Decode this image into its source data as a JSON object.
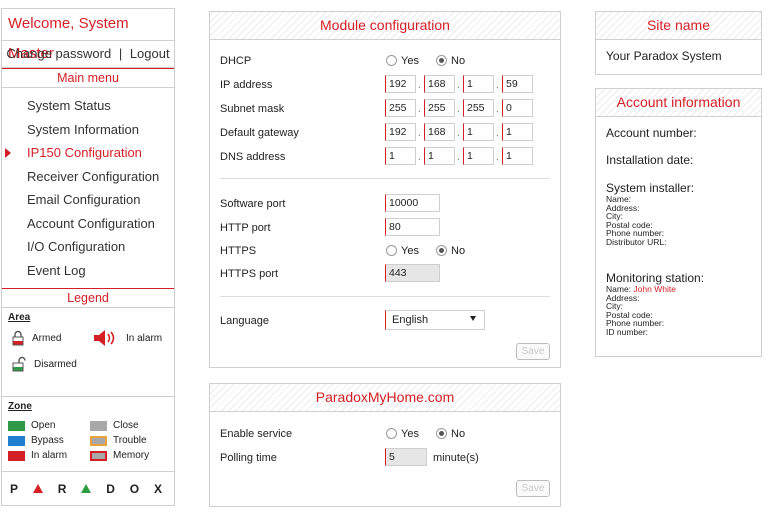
{
  "sidebar": {
    "welcome": "Welcome, System Master",
    "change_password": "Change password",
    "separator": "|",
    "logout": "Logout",
    "main_menu_title": "Main menu",
    "menu_items": [
      {
        "label": "System Status"
      },
      {
        "label": "System Information"
      },
      {
        "label": "IP150 Configuration"
      },
      {
        "label": "Receiver Configuration"
      },
      {
        "label": "Email Configuration"
      },
      {
        "label": "Account Configuration"
      },
      {
        "label": "I/O Configuration"
      },
      {
        "label": "Event Log"
      }
    ],
    "active_item": "IP150 Configuration",
    "legend_title": "Legend",
    "legend": {
      "area_title": "Area",
      "armed": "Armed",
      "in_alarm": "In alarm",
      "disarmed": "Disarmed",
      "zone_title": "Zone",
      "zones": [
        {
          "label": "Open",
          "color": "#2e9a47"
        },
        {
          "label": "Close",
          "color": "#a8a8a8"
        },
        {
          "label": "Bypass",
          "color": "#1f7fd0"
        },
        {
          "label": "Trouble",
          "color": "#e8a33a"
        },
        {
          "label": "In alarm",
          "color": "#d51f26"
        },
        {
          "label": "Memory",
          "color": "#a8a8a8"
        }
      ]
    },
    "logo_letters": [
      "P",
      "R",
      "D",
      "O",
      "X"
    ]
  },
  "module": {
    "title": "Module configuration",
    "dhcp_label": "DHCP",
    "yes": "Yes",
    "no": "No",
    "ip_label": "IP address",
    "ip": [
      "192",
      "168",
      "1",
      "59"
    ],
    "subnet_label": "Subnet mask",
    "subnet": [
      "255",
      "255",
      "255",
      "0"
    ],
    "gateway_label": "Default gateway",
    "gateway": [
      "192",
      "168",
      "1",
      "1"
    ],
    "dns_label": "DNS address",
    "dns": [
      "1",
      "1",
      "1",
      "1"
    ],
    "software_port_label": "Software port",
    "software_port": "10000",
    "http_port_label": "HTTP port",
    "http_port": "80",
    "https_label": "HTTPS",
    "https_port_label": "HTTPS port",
    "https_port": "443",
    "language_label": "Language",
    "language": "English",
    "save": "Save"
  },
  "paradox_home": {
    "title": "ParadoxMyHome.com",
    "enable_label": "Enable service",
    "yes": "Yes",
    "no": "No",
    "polling_label": "Polling time",
    "polling_value": "5",
    "polling_unit": "minute(s)",
    "save": "Save"
  },
  "site": {
    "title": "Site name",
    "name": "Your Paradox System"
  },
  "account": {
    "title": "Account information",
    "account_number": "Account number:",
    "installation_date": "Installation date:",
    "installer_title": "System installer:",
    "installer_fields": [
      "Name:",
      "Address:",
      "City:",
      "Postal code:",
      "Phone number:",
      "Distributor URL:"
    ],
    "monitoring_title": "Monitoring station:",
    "monitoring_name_label": "Name:",
    "monitoring_name": "John White",
    "monitoring_fields": [
      "Address:",
      "City:",
      "Postal code:",
      "Phone number:",
      "ID number:"
    ]
  }
}
